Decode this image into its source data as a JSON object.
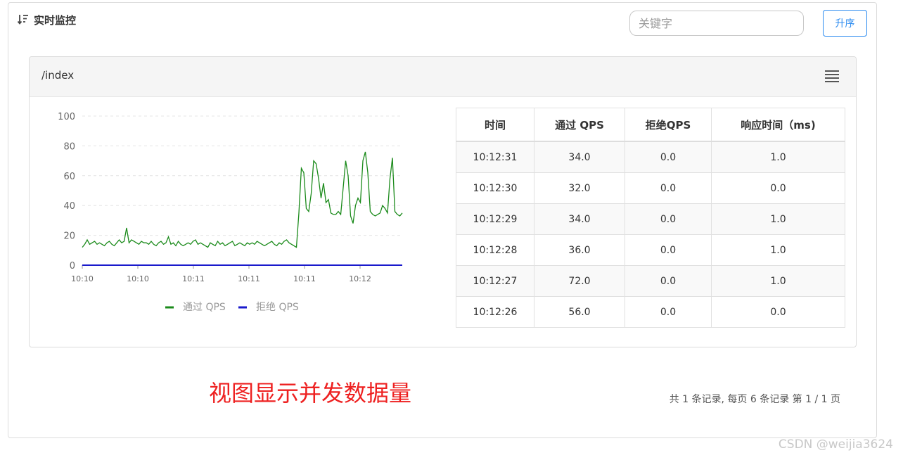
{
  "header": {
    "title": "实时监控",
    "sort_icon": "sort-desc-icon"
  },
  "search": {
    "placeholder": "关键字",
    "value": ""
  },
  "sort_button": {
    "label": "升序"
  },
  "resource": {
    "name": "/index",
    "menu_icon": "list-menu-icon"
  },
  "chart_data": {
    "type": "line",
    "y_ticks": [
      "100",
      "80",
      "60",
      "40",
      "20",
      "0"
    ],
    "x_ticks": [
      "10:10",
      "10:10",
      "10:11",
      "10:11",
      "10:11",
      "10:12"
    ],
    "ylim": [
      0,
      100
    ],
    "grid": "horizontal dashed",
    "legend_position": "bottom",
    "series": [
      {
        "name": "通过 QPS",
        "color": "#1a8a1a",
        "values": [
          12,
          14,
          17,
          14,
          15,
          16,
          14,
          15,
          14,
          13,
          15,
          16,
          14,
          13,
          15,
          17,
          15,
          16,
          25,
          15,
          17,
          16,
          15,
          14,
          16,
          15,
          15,
          14,
          16,
          14,
          13,
          15,
          16,
          14,
          15,
          19,
          14,
          15,
          13,
          16,
          14,
          13,
          14,
          15,
          14,
          16,
          17,
          14,
          15,
          14,
          13,
          12,
          15,
          14,
          13,
          16,
          14,
          15,
          13,
          14,
          15,
          16,
          13,
          14,
          15,
          14,
          13,
          15,
          14,
          15,
          14,
          16,
          15,
          14,
          13,
          14,
          15,
          16,
          14,
          13,
          15,
          14,
          16,
          17,
          15,
          14,
          13,
          12,
          35,
          65,
          62,
          38,
          36,
          48,
          70,
          68,
          58,
          45,
          55,
          42,
          44,
          35,
          34,
          34,
          36,
          34,
          52,
          70,
          60,
          33,
          28,
          40,
          45,
          42,
          70,
          76,
          62,
          36,
          34,
          33,
          34,
          35,
          40,
          38,
          35,
          58,
          72,
          36,
          34,
          33,
          35
        ]
      },
      {
        "name": "拒绝 QPS",
        "color": "#1a1acc",
        "values": [
          0,
          0,
          0,
          0,
          0,
          0,
          0,
          0,
          0,
          0,
          0,
          0,
          0,
          0,
          0,
          0,
          0,
          0,
          0,
          0,
          0,
          0,
          0,
          0,
          0,
          0,
          0,
          0,
          0,
          0,
          0,
          0,
          0,
          0,
          0,
          0,
          0,
          0,
          0,
          0,
          0,
          0,
          0,
          0,
          0,
          0,
          0,
          0,
          0,
          0,
          0,
          0,
          0,
          0,
          0,
          0,
          0,
          0,
          0,
          0,
          0,
          0,
          0,
          0,
          0,
          0,
          0,
          0,
          0,
          0,
          0,
          0,
          0,
          0,
          0,
          0,
          0,
          0,
          0,
          0,
          0,
          0,
          0,
          0,
          0,
          0,
          0,
          0,
          0,
          0,
          0,
          0,
          0,
          0,
          0,
          0,
          0,
          0,
          0,
          0,
          0,
          0,
          0,
          0,
          0,
          0,
          0,
          0,
          0,
          0,
          0,
          0,
          0,
          0,
          0,
          0,
          0,
          0,
          0,
          0,
          0,
          0,
          0,
          0,
          0,
          0,
          0,
          0,
          0,
          0,
          0
        ]
      }
    ]
  },
  "table": {
    "headers": [
      "时间",
      "通过 QPS",
      "拒绝QPS",
      "响应时间（ms)"
    ],
    "rows": [
      [
        "10:12:31",
        "34.0",
        "0.0",
        "1.0"
      ],
      [
        "10:12:30",
        "32.0",
        "0.0",
        "0.0"
      ],
      [
        "10:12:29",
        "34.0",
        "0.0",
        "1.0"
      ],
      [
        "10:12:28",
        "36.0",
        "0.0",
        "1.0"
      ],
      [
        "10:12:27",
        "72.0",
        "0.0",
        "1.0"
      ],
      [
        "10:12:26",
        "56.0",
        "0.0",
        "0.0"
      ]
    ]
  },
  "annotation": "视图显示并发数据量",
  "pagination": "共 1 条记录, 每页 6 条记录 第 1 / 1 页",
  "watermark": "CSDN @weijia3624"
}
